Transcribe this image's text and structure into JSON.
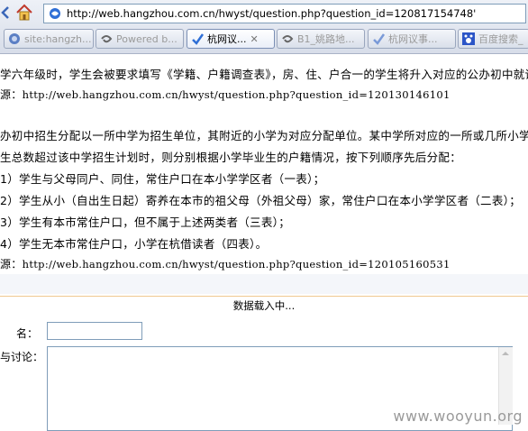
{
  "browser": {
    "url": "http://web.hangzhou.com.cn/hwyst/question.php?question_id=120817154748'",
    "tabs": [
      {
        "label": "site:hangzh...",
        "active": false
      },
      {
        "label": "Powered b...",
        "active": false
      },
      {
        "label": "杭网议...",
        "active": true
      },
      {
        "label": "B1_姚路地...",
        "active": false
      },
      {
        "label": "杭网议事...",
        "active": false
      },
      {
        "label": "百度搜索_",
        "active": false
      }
    ]
  },
  "content": {
    "lines": [
      "学六年级时，学生会被要求填写《学籍、户籍调查表》，房、住、户合一的学生将升入对应的公办初中就读。",
      "源：",
      "办初中招生分配以一所中学为招生单位，其附近的小学为对应分配单位。某中学所对应的一所或几所小学的毕",
      "生总数超过该中学招生计划时，则分别根据小学毕业生的户籍情况，按下列顺序先后分配：",
      "1）学生与父母同户、同住，常住户口在本小学学区者（一表）；",
      "2）学生从小（自出生日起）寄养在本市的祖父母（外祖父母）家，常住户口在本小学学区者（二表）；",
      "3）学生有本市常住户口，但不属于上述两类者（三表）；",
      "4）学生无本市常住户口，小学在杭借读者（四表）。",
      "源："
    ],
    "source_urls": [
      "http://web.hangzhou.com.cn/hwyst/question.php?question_id=120130146101",
      "http://web.hangzhou.com.cn/hwyst/question.php?question_id=120105160531"
    ]
  },
  "loading_text": "数据载入中...",
  "form": {
    "name_label": "名：",
    "comment_label": "与讨论：",
    "name_value": "",
    "comment_value": ""
  },
  "watermark": "www.wooyun.org",
  "colors": {
    "tab_active_text": "#000000",
    "tab_inactive_text": "#9a9a9a",
    "divider": "#f0c890"
  }
}
